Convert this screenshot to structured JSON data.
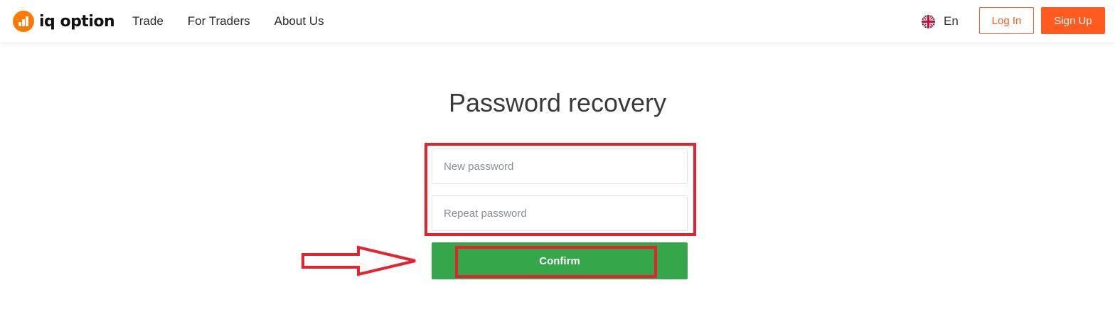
{
  "header": {
    "logo_text": "iq option",
    "nav": [
      {
        "label": "Trade"
      },
      {
        "label": "For Traders"
      },
      {
        "label": "About Us"
      }
    ],
    "language": "En",
    "login_label": "Log In",
    "signup_label": "Sign Up"
  },
  "main": {
    "title": "Password recovery",
    "new_password_placeholder": "New password",
    "repeat_password_placeholder": "Repeat password",
    "confirm_label": "Confirm"
  },
  "colors": {
    "brand_orange": "#ff5a1f",
    "logo_orange": "#ff7a00",
    "confirm_green": "#35a64a",
    "annotation_red": "#e5222e"
  },
  "icons": {
    "logo": "iq-option-logo-icon",
    "flag": "uk-flag-icon",
    "arrow": "right-arrow-icon"
  }
}
